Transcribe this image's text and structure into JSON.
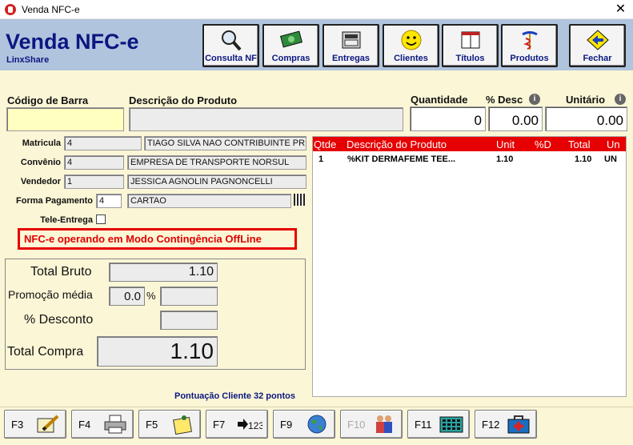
{
  "window": {
    "title": "Venda NFC-e",
    "close_glyph": "✕"
  },
  "header": {
    "title": "Venda NFC-e",
    "subtitle": "LinxShare"
  },
  "toolbar": [
    {
      "label": "Consulta NF",
      "icon": "magnifier-icon"
    },
    {
      "label": "Compras",
      "icon": "money-icon"
    },
    {
      "label": "Entregas",
      "icon": "cash-register-icon"
    },
    {
      "label": "Clientes",
      "icon": "smiley-icon"
    },
    {
      "label": "Títulos",
      "icon": "book-icon"
    },
    {
      "label": "Produtos",
      "icon": "caduceus-icon"
    },
    {
      "label": "Fechar",
      "icon": "back-arrow-icon"
    }
  ],
  "product_entry": {
    "barcode_label": "Código de Barra",
    "barcode_value": "",
    "description_label": "Descrição do Produto",
    "description_value": "",
    "quantity_label": "Quantidade",
    "quantity_value": "0",
    "discount_label": "% Desc",
    "discount_value": "0.00",
    "unit_label": "Unitário",
    "unit_value": "0.00"
  },
  "customer": {
    "matricula_label": "Matricula",
    "matricula_code": "4",
    "matricula_name": "TIAGO SILVA NAO CONTRIBUINTE PR",
    "convenio_label": "Convênio",
    "convenio_code": "4",
    "convenio_name": "EMPRESA DE TRANSPORTE NORSUL",
    "vendedor_label": "Vendedor",
    "vendedor_code": "1",
    "vendedor_name": "JESSICA AGNOLIN PAGNONCELLI",
    "pagamento_label": "Forma Pagamento",
    "pagamento_code": "4",
    "pagamento_name": "CARTAO",
    "tele_entrega_label": "Tele-Entrega",
    "tele_entrega_checked": false
  },
  "warning": "NFC-e operando em Modo Contingência OffLine",
  "totals": {
    "bruto_label": "Total Bruto",
    "bruto_value": "1.10",
    "promo_label": "Promoção média",
    "promo_value": "0.0",
    "promo_unit": "%",
    "promo_amount": "",
    "desconto_label": "% Desconto",
    "desconto_value": "",
    "compra_label": "Total Compra",
    "compra_value": "1.10"
  },
  "items_table": {
    "columns": [
      "Qtde",
      "Descrição do Produto",
      "Unit",
      "%D",
      "Total",
      "Un"
    ],
    "rows": [
      [
        "1",
        "%KIT DERMAFEME TEE...",
        "1.10",
        "",
        "1.10",
        "UN"
      ]
    ]
  },
  "pontuacao": "Pontuação Cliente 32 pontos",
  "fkeys": [
    {
      "key": "F3",
      "icon": "edit-pencil-icon",
      "enabled": true
    },
    {
      "key": "F4",
      "icon": "printer-icon",
      "enabled": true
    },
    {
      "key": "F5",
      "icon": "notepad-pin-icon",
      "enabled": true
    },
    {
      "key": "F7",
      "icon": "arrow-123-icon",
      "enabled": true
    },
    {
      "key": "F9",
      "icon": "globe-icon",
      "enabled": true
    },
    {
      "key": "F10",
      "icon": "people-icon",
      "enabled": false
    },
    {
      "key": "F11",
      "icon": "keypad-icon",
      "enabled": true
    },
    {
      "key": "F12",
      "icon": "medical-kit-icon",
      "enabled": true
    }
  ]
}
